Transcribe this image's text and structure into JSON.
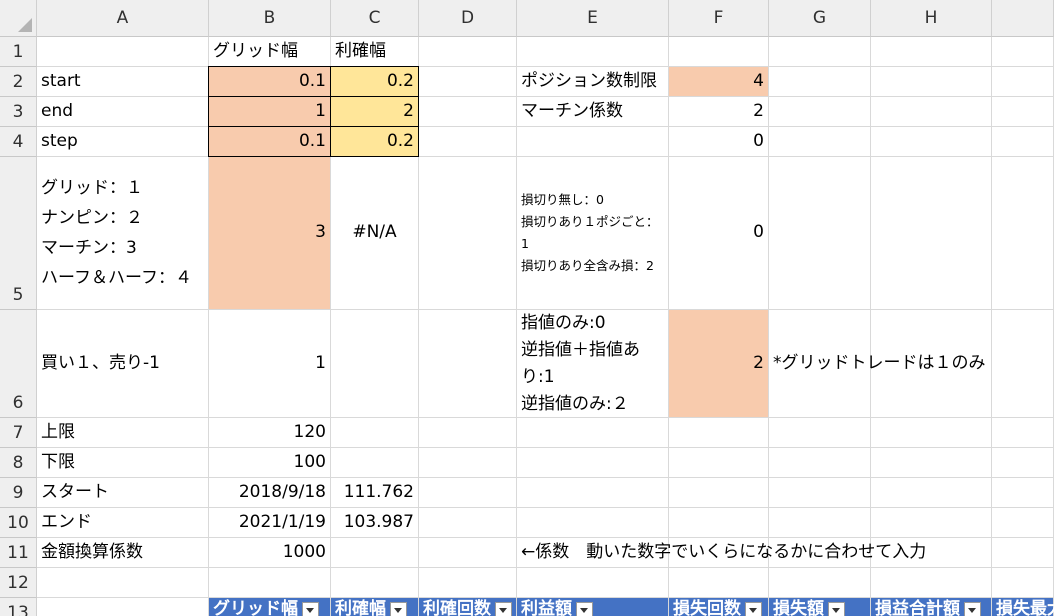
{
  "columns": [
    {
      "letter": "",
      "w": 37
    },
    {
      "letter": "A",
      "w": 172
    },
    {
      "letter": "B",
      "w": 122
    },
    {
      "letter": "C",
      "w": 88
    },
    {
      "letter": "D",
      "w": 98
    },
    {
      "letter": "E",
      "w": 152
    },
    {
      "letter": "F",
      "w": 100
    },
    {
      "letter": "G",
      "w": 102
    },
    {
      "letter": "H",
      "w": 121
    },
    {
      "letter": "",
      "w": 62
    }
  ],
  "rows": [
    {
      "num": "1",
      "h": 30
    },
    {
      "num": "2",
      "h": 30
    },
    {
      "num": "3",
      "h": 30
    },
    {
      "num": "4",
      "h": 30
    },
    {
      "num": "5",
      "h": 153
    },
    {
      "num": "6",
      "h": 108
    },
    {
      "num": "7",
      "h": 30
    },
    {
      "num": "8",
      "h": 30
    },
    {
      "num": "9",
      "h": 30
    },
    {
      "num": "10",
      "h": 30
    },
    {
      "num": "11",
      "h": 30
    },
    {
      "num": "12",
      "h": 30
    },
    {
      "num": "13",
      "h": 30
    }
  ],
  "fills": {
    "orange": "#f8cbad",
    "yellow": "#ffe699",
    "header_blue": "#4472c4"
  },
  "cells": [
    {
      "ref": "B1",
      "text": "グリッド幅",
      "align": "l"
    },
    {
      "ref": "C1",
      "text": "利確幅",
      "align": "l"
    },
    {
      "ref": "A2",
      "text": "start",
      "align": "l"
    },
    {
      "ref": "B2",
      "text": "0.1",
      "align": "r",
      "fill": "orange",
      "border": true
    },
    {
      "ref": "C2",
      "text": "0.2",
      "align": "r",
      "fill": "yellow",
      "border": true
    },
    {
      "ref": "E2",
      "text": "ポジション数制限",
      "align": "l"
    },
    {
      "ref": "F2",
      "text": "4",
      "align": "r",
      "fill": "orange"
    },
    {
      "ref": "A3",
      "text": "end",
      "align": "l"
    },
    {
      "ref": "B3",
      "text": "1",
      "align": "r",
      "fill": "orange",
      "border": true
    },
    {
      "ref": "C3",
      "text": "2",
      "align": "r",
      "fill": "yellow",
      "border": true
    },
    {
      "ref": "E3",
      "text": "マーチン係数",
      "align": "l"
    },
    {
      "ref": "F3",
      "text": "2",
      "align": "r"
    },
    {
      "ref": "A4",
      "text": "step",
      "align": "l"
    },
    {
      "ref": "B4",
      "text": "0.1",
      "align": "r",
      "fill": "orange",
      "border": true
    },
    {
      "ref": "C4",
      "text": "0.2",
      "align": "r",
      "fill": "yellow",
      "border": true
    },
    {
      "ref": "F4",
      "text": "0",
      "align": "r"
    },
    {
      "ref": "A5",
      "lines": [
        "グリッド：１",
        "ナンピン：２",
        "マーチン：3",
        "ハーフ＆ハーフ：４"
      ],
      "align": "ml",
      "lh": 30
    },
    {
      "ref": "B5",
      "text": "3",
      "align": "r",
      "fill": "orange"
    },
    {
      "ref": "C5",
      "text": "#N/A",
      "align": "c"
    },
    {
      "ref": "E5",
      "lines": [
        "損切り無し：0",
        "損切りあり１ポジごと：",
        "1",
        "損切りあり全含み損：2"
      ],
      "align": "ml",
      "small": true
    },
    {
      "ref": "F5",
      "text": "0",
      "align": "r"
    },
    {
      "ref": "A6",
      "text": "買い１、売り-1",
      "align": "l"
    },
    {
      "ref": "B6",
      "text": "1",
      "align": "r"
    },
    {
      "ref": "E6",
      "lines": [
        "指値のみ:0",
        "逆指値＋指値あ",
        "り:1",
        "逆指値のみ:２"
      ],
      "align": "ml",
      "lh": 27
    },
    {
      "ref": "F6",
      "text": "2",
      "align": "r",
      "fill": "orange"
    },
    {
      "ref": "G6",
      "text": "*グリッドトレードは１のみ",
      "align": "l",
      "over": true
    },
    {
      "ref": "A7",
      "text": "上限",
      "align": "l"
    },
    {
      "ref": "B7",
      "text": "120",
      "align": "r"
    },
    {
      "ref": "A8",
      "text": "下限",
      "align": "l"
    },
    {
      "ref": "B8",
      "text": "100",
      "align": "r"
    },
    {
      "ref": "A9",
      "text": "スタート",
      "align": "l"
    },
    {
      "ref": "B9",
      "text": "2018/9/18",
      "align": "r"
    },
    {
      "ref": "C9",
      "text": "111.762",
      "align": "r"
    },
    {
      "ref": "A10",
      "text": "エンド",
      "align": "l"
    },
    {
      "ref": "B10",
      "text": "2021/1/19",
      "align": "r"
    },
    {
      "ref": "C10",
      "text": "103.987",
      "align": "r"
    },
    {
      "ref": "A11",
      "text": "金額換算係数",
      "align": "l"
    },
    {
      "ref": "B11",
      "text": "1000",
      "align": "r"
    },
    {
      "ref": "E11",
      "text": "←係数　動いた数字でいくらになるかに合わせて入力",
      "align": "l",
      "over": true
    },
    {
      "ref": "B13",
      "text": "グリッド幅",
      "head": true
    },
    {
      "ref": "C13",
      "text": "利確幅",
      "head": true
    },
    {
      "ref": "D13",
      "text": "利確回数",
      "head": true
    },
    {
      "ref": "E13",
      "text": "利益額",
      "head": true
    },
    {
      "ref": "F13",
      "text": "損失回数",
      "head": true
    },
    {
      "ref": "G13",
      "text": "損失額",
      "head": true
    },
    {
      "ref": "H13",
      "text": "損益合計額",
      "head": true
    },
    {
      "ref": "I13",
      "text": "損失最大",
      "head": true
    }
  ]
}
